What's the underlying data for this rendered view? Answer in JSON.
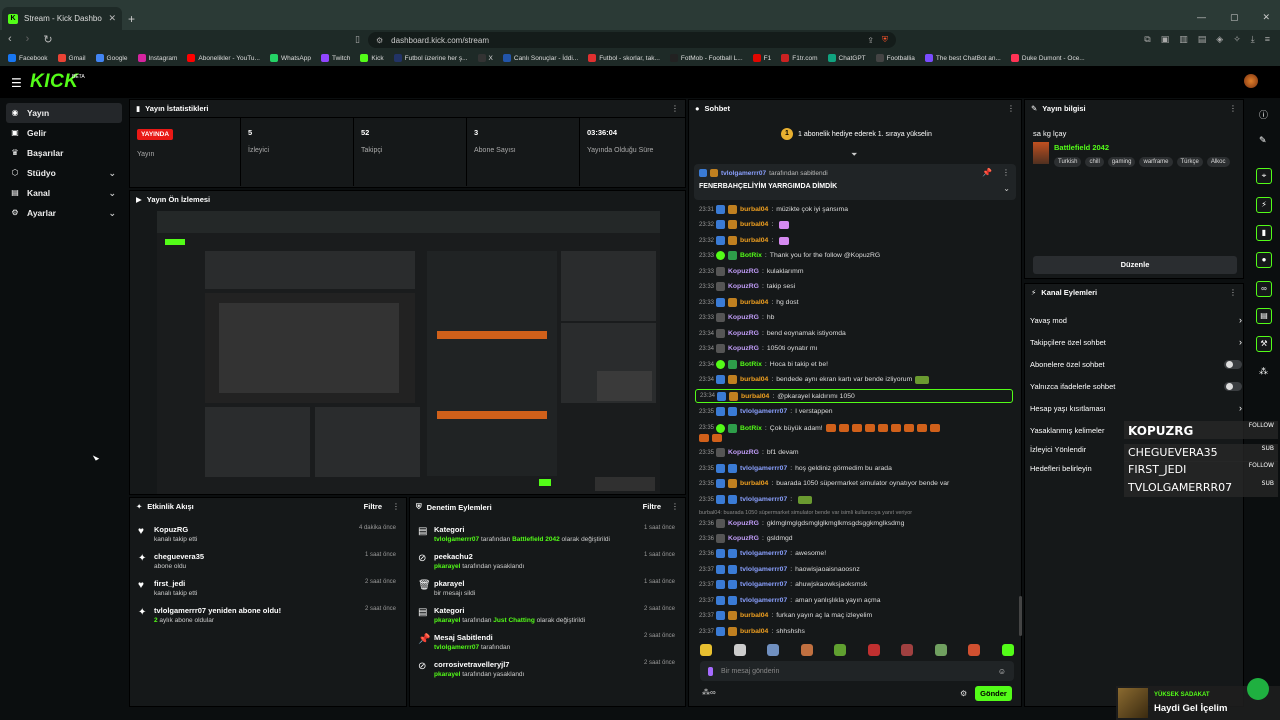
{
  "browser": {
    "tab_title": "Stream - Kick Dashboard",
    "url": "dashboard.kick.com/stream",
    "bookmarks": [
      {
        "label": "Facebook",
        "color": "#1877f2"
      },
      {
        "label": "Gmail",
        "color": "#ea4335"
      },
      {
        "label": "Google",
        "color": "#4285f4"
      },
      {
        "label": "Instagram",
        "color": "#d6249f"
      },
      {
        "label": "Abonelikler - YouTu...",
        "color": "#ff0000"
      },
      {
        "label": "WhatsApp",
        "color": "#25d366"
      },
      {
        "label": "Twitch",
        "color": "#9146ff"
      },
      {
        "label": "Kick",
        "color": "#53fc18"
      },
      {
        "label": "Futbol üzerine her ş...",
        "color": "#223366"
      },
      {
        "label": "X",
        "color": "#333333"
      },
      {
        "label": "Canlı Sonuçlar - İddi...",
        "color": "#2255aa"
      },
      {
        "label": "Futbol - skorlar, tak...",
        "color": "#e03030"
      },
      {
        "label": "FotMob - Football L...",
        "color": "#222222"
      },
      {
        "label": "F1",
        "color": "#e10600"
      },
      {
        "label": "F1tr.com",
        "color": "#cc2222"
      },
      {
        "label": "ChatGPT",
        "color": "#10a37f"
      },
      {
        "label": "Footballia",
        "color": "#444444"
      },
      {
        "label": "The best ChatBot an...",
        "color": "#7a4cff"
      },
      {
        "label": "Duke Dumont - Oce...",
        "color": "#ff3355"
      }
    ]
  },
  "header": {
    "logo": "KICK",
    "beta": "BETA"
  },
  "sidebar": {
    "items": [
      {
        "label": "Yayın",
        "icon": "broadcast-icon",
        "active": true
      },
      {
        "label": "Gelir",
        "icon": "wallet-icon"
      },
      {
        "label": "Başarılar",
        "icon": "trophy-icon"
      },
      {
        "label": "Stüdyo",
        "icon": "studio-icon",
        "chevron": true
      },
      {
        "label": "Kanal",
        "icon": "channel-icon",
        "chevron": true
      },
      {
        "label": "Ayarlar",
        "icon": "gear-icon",
        "chevron": true
      }
    ]
  },
  "stats": {
    "title": "Yayın İstatistikleri",
    "live_badge": "YAYINDA",
    "live_label": "Yayın",
    "items": [
      {
        "value": "5",
        "label": "İzleyici"
      },
      {
        "value": "52",
        "label": "Takipçi"
      },
      {
        "value": "3",
        "label": "Abone Sayısı"
      },
      {
        "value": "03:36:04",
        "label": "Yayında Olduğu Süre"
      }
    ]
  },
  "preview": {
    "title": "Yayın Ön İzlemesi"
  },
  "activity": {
    "title": "Etkinlik Akışı",
    "filter": "Filtre",
    "rows": [
      {
        "icon": "heart-icon",
        "name": "KopuzRG",
        "detail": "kanalı takip etti",
        "time": "4 dakika önce"
      },
      {
        "icon": "star-icon",
        "name": "cheguevera35",
        "detail": "abone oldu",
        "time": "1 saat önce"
      },
      {
        "icon": "heart-icon",
        "name": "first_jedi",
        "detail": "kanalı takip etti",
        "time": "2 saat önce"
      },
      {
        "icon": "star-icon",
        "name": "tvlolgamerrr07 yeniden abone oldu!",
        "detail_green": "2",
        "detail": " aylık abone oldular",
        "time": "2 saat önce"
      }
    ]
  },
  "moderation": {
    "title": "Denetim Eylemleri",
    "filter": "Filtre",
    "rows": [
      {
        "icon": "category-icon",
        "title": "Kategori",
        "user": "tvlolgamerrr07",
        "mid": " tarafından ",
        "green2": "Battlefield 2042",
        "tail": " olarak değiştirildi",
        "time": "1 saat önce"
      },
      {
        "icon": "ban-icon",
        "title": "peekachu2",
        "user": "pkarayel",
        "mid": " tarafından yasaklandı",
        "green2": "",
        "tail": "",
        "time": "1 saat önce"
      },
      {
        "icon": "trash-icon",
        "title": "pkarayel",
        "user": "",
        "mid": "bir mesajı sildi",
        "green2": "",
        "tail": "",
        "time": "1 saat önce"
      },
      {
        "icon": "category-icon",
        "title": "Kategori",
        "user": "pkarayel",
        "mid": " tarafından ",
        "green2": "Just Chatting",
        "tail": " olarak değiştirildi",
        "time": "2 saat önce"
      },
      {
        "icon": "pin-icon",
        "title": "Mesaj Sabitlendi",
        "user": "tvlolgamerrr07",
        "mid": " tarafından",
        "green2": "",
        "tail": "",
        "time": "2 saat önce"
      },
      {
        "icon": "ban-icon",
        "title": "corrosivetravelleryjl7",
        "user": "pkarayel",
        "mid": " tarafından yasaklandı",
        "green2": "",
        "tail": "",
        "time": "2 saat önce"
      }
    ]
  },
  "chat": {
    "title": "Sohbet",
    "gift_banner": "1 abonelik hediye ederek 1. sıraya yükselin",
    "pinned_user": "tvlolgamerrr07",
    "pinned_by": "tarafından sabitlendi",
    "pinned_msg": "FENERBAHÇELİYİM YARRGIMDA DİMDİK",
    "messages": [
      {
        "t": "23:31",
        "u": "burbal04",
        "c": "uo",
        "m": "müzikte çok iyi şansıma"
      },
      {
        "t": "23:32",
        "u": "burbal04",
        "c": "uo",
        "m": ""
      },
      {
        "t": "23:32",
        "u": "burbal04",
        "c": "uo",
        "m": ""
      },
      {
        "t": "23:33",
        "u": "BotRix",
        "c": "ug",
        "m": "Thank you for the follow @KopuzRG"
      },
      {
        "t": "23:33",
        "u": "KopuzRG",
        "c": "up",
        "m": "kulaklarımm"
      },
      {
        "t": "23:33",
        "u": "KopuzRG",
        "c": "up",
        "m": "takip sesi"
      },
      {
        "t": "23:33",
        "u": "burbal04",
        "c": "uo",
        "m": "hg dost"
      },
      {
        "t": "23:33",
        "u": "KopuzRG",
        "c": "up",
        "m": "hb"
      },
      {
        "t": "23:34",
        "u": "KopuzRG",
        "c": "up",
        "m": "bend eoynamak istiyomda"
      },
      {
        "t": "23:34",
        "u": "KopuzRG",
        "c": "up",
        "m": "1050ti oynatır mı"
      },
      {
        "t": "23:34",
        "u": "BotRix",
        "c": "ug",
        "m": "Hoca bi takip et be!"
      },
      {
        "t": "23:34",
        "u": "burbal04",
        "c": "uo",
        "m": "bendede aynı ekran kartı var bende izliyorum"
      },
      {
        "t": "23:34",
        "u": "burbal04",
        "c": "uo",
        "m": "@pkarayel kaldırımı 1050"
      },
      {
        "t": "23:35",
        "u": "tvlolgamerrr07",
        "c": "ub",
        "m": "I verstappen"
      },
      {
        "t": "23:35",
        "u": "BotRix",
        "c": "ug",
        "m": "Çok büyük adam!"
      },
      {
        "t": "23:35",
        "u": "KopuzRG",
        "c": "up",
        "m": "bf1 devam"
      },
      {
        "t": "23:35",
        "u": "tvlolgamerrr07",
        "c": "ub",
        "m": "hoş geldiniz görmedim bu arada"
      },
      {
        "t": "23:35",
        "u": "burbal04",
        "c": "uo",
        "m": "buarada 1050 süpermarket simulator oynatıyor bende var"
      },
      {
        "t": "23:35",
        "u": "tvlolgamerrr07",
        "c": "ub",
        "m": ""
      },
      {
        "t": "23:36",
        "u": "KopuzRG",
        "c": "up",
        "m": "gklmglmglgdsmglglkmglkmsgdsggkmglksdmg"
      },
      {
        "t": "23:36",
        "u": "KopuzRG",
        "c": "up",
        "m": "gsldmgd"
      },
      {
        "t": "23:36",
        "u": "tvlolgamerrr07",
        "c": "ub",
        "m": "awesome!"
      },
      {
        "t": "23:37",
        "u": "tvlolgamerrr07",
        "c": "ub",
        "m": "haowisjaoaisnaoosnz"
      },
      {
        "t": "23:37",
        "u": "tvlolgamerrr07",
        "c": "ub",
        "m": "ahuwjskaowksjaoksmsk"
      },
      {
        "t": "23:37",
        "u": "tvlolgamerrr07",
        "c": "ub",
        "m": "aman yanlışlıkla yayın açma"
      },
      {
        "t": "23:37",
        "u": "burbal04",
        "c": "uo",
        "m": "furkan yayın aç la maç izleyelim"
      },
      {
        "t": "23:37",
        "u": "burbal04",
        "c": "uo",
        "m": "shhshshs"
      }
    ],
    "reply_hint": "burbal04: buarada 1050 süpermarket simulator bende var isimli kullanıcıya yanıt veriyor",
    "input_placeholder": "Bir mesaj gönderin",
    "send": "Gönder"
  },
  "stream_info": {
    "title": "Yayın bilgisi",
    "stream_title": "sa kg lçay",
    "category": "Battlefield 2042",
    "tags": [
      "Turkish",
      "chill",
      "gaming",
      "warframe",
      "Türkçe",
      "Alkoc"
    ],
    "edit": "Düzenle"
  },
  "channel_actions": {
    "title": "Kanal Eylemleri",
    "rows": [
      {
        "label": "Yavaş mod",
        "kind": "chevron"
      },
      {
        "label": "Takipçilere özel sohbet",
        "kind": "chevron"
      },
      {
        "label": "Abonelere özel sohbet",
        "kind": "toggle"
      },
      {
        "label": "Yalnızca ifadelerle sohbet",
        "kind": "toggle"
      },
      {
        "label": "Hesap yaşı kısıtlaması",
        "kind": "chevron"
      },
      {
        "label": "Yasaklanmış kelimeler",
        "kind": "none"
      },
      {
        "label": "İzleyici Yönlendir",
        "kind": "none"
      },
      {
        "label": "Hedefleri belirleyin",
        "kind": "none"
      }
    ]
  },
  "overlay": {
    "rows": [
      {
        "name": "KOPUZRG",
        "tag": "FOLLOW"
      },
      {
        "name": "CHEGUEVERA35",
        "tag": "SUB"
      },
      {
        "name": "FIRST_JEDI",
        "tag": "FOLLOW"
      },
      {
        "name": "TVLOLGAMERRR07",
        "tag": "SUB"
      }
    ],
    "loyalty_label": "YÜKSEK SADAKAT",
    "loyalty_name": "Haydi Gel İçelim"
  }
}
